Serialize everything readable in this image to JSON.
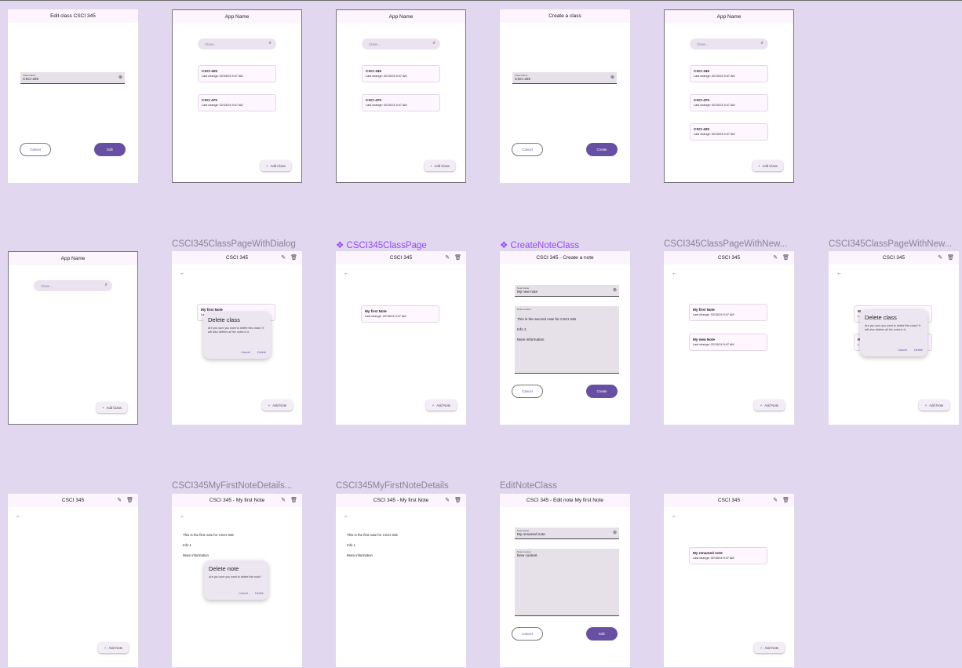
{
  "labels": {
    "f7": "CSCI345ClassPageWithDialog",
    "f8": "CSCI345ClassPage",
    "f9": "CreateNoteClass",
    "f10": "CSCI345ClassPageWithNew...",
    "f11": "CSCI345ClassPageWithNew...",
    "f13": "CSCI345MyFirstNoteDetails...",
    "f14": "CSCI345MyFirstNoteDetails",
    "f15": "EditNoteClass"
  },
  "icons": {
    "diamond": "❖",
    "search": "⌕",
    "clear": "⊗",
    "back": "←",
    "edit": "✎",
    "delete": "🗑",
    "plus": "+"
  },
  "f1": {
    "title": "Edit class CSCI 345",
    "field_label": "Class Name",
    "field_value": "CSCI 425",
    "cancel": "Cancel",
    "action": "Edit"
  },
  "f2": {
    "title": "App Name",
    "search": "Class...",
    "cards": [
      {
        "title": "CSCI 425",
        "sub": "Last change: 02/15/24 9:47 AM"
      },
      {
        "title": "CSCI 470",
        "sub": "Last change: 02/15/24 9:47 AM"
      }
    ],
    "fab": "Add Class"
  },
  "f3": {
    "title": "App Name",
    "search": "Class...",
    "cards": [
      {
        "title": "CSCI 345",
        "sub": "Last change: 02/15/24 9:47 AM"
      },
      {
        "title": "CSCI 470",
        "sub": "Last change: 02/15/24 9:47 AM"
      }
    ],
    "fab": "Add Class"
  },
  "f4": {
    "title": "Create a class",
    "field_label": "Class Name",
    "field_value": "CSCI 425",
    "cancel": "Cancel",
    "action": "Create"
  },
  "f5": {
    "title": "App Name",
    "search": "Class...",
    "cards": [
      {
        "title": "CSCI 345",
        "sub": "Last change: 02/15/24 9:47 AM"
      },
      {
        "title": "CSCI 470",
        "sub": "Last change: 02/15/24 9:47 AM"
      },
      {
        "title": "CSCI 425",
        "sub": "Last change: 02/15/24 9:47 AM"
      }
    ],
    "fab": "Add Class"
  },
  "f6": {
    "title": "App Name",
    "search": "Class...",
    "fab": "Add Class"
  },
  "f7": {
    "title": "CSCI 345",
    "card": "My first Note",
    "card_sub": "La",
    "dialog_title": "Delete class",
    "dialog_body": "Are you sure you want to delete this class? It will also deletes all the notes in it.",
    "cancel": "Cancel",
    "delete": "Delete",
    "fab": "Add Note"
  },
  "f8": {
    "title": "CSCI 345",
    "card": "My first Note",
    "card_sub": "Last change: 02/15/24 9:47 AM",
    "fab": "Add Note"
  },
  "f9": {
    "title": "CSCI 345 - Create a note",
    "name_label": "Note Name",
    "name_value": "My new note",
    "content_label": "Note Content",
    "lines": [
      "This is the second note for CSCI 345",
      "Info 1",
      "More information"
    ],
    "cancel": "Cancel",
    "action": "Create"
  },
  "f10": {
    "title": "CSCI 345",
    "cards": [
      {
        "title": "My first Note",
        "sub": "Last change: 02/15/24 9:47 AM"
      },
      {
        "title": "My new Note",
        "sub": "Last change: 02/15/24 9:47 AM"
      }
    ],
    "fab": "Add Note"
  },
  "f11": {
    "title": "CSCI 345",
    "peek1": "M",
    "peek2": "L",
    "peek3": "M",
    "peek4": "L",
    "dialog_title": "Delete class",
    "dialog_body": "Are you sure you want to delete this class? It will also deletes all the notes in it.",
    "cancel": "Cancel",
    "delete": "Delete",
    "fab": "Add Note"
  },
  "f12": {
    "title": "CSCI 345",
    "fab": "Add Note"
  },
  "f13": {
    "title": "CSCI 345 - My first Note",
    "lines": [
      "This is the first note for CSCI 345",
      "Info 1",
      "More information"
    ],
    "dialog_title": "Delete note",
    "dialog_body": "Are you sure you want to delete this note?",
    "cancel": "Cancel",
    "delete": "Delete"
  },
  "f14": {
    "title": "CSCI 345 - My first Note",
    "lines": [
      "This is the first note for CSCI 345",
      "Info 1",
      "More information"
    ]
  },
  "f15": {
    "title": "CSCI 345 - Edit note My first Note",
    "name_label": "Note Name",
    "name_value": "My renamed note",
    "content_label": "Note Content",
    "content_value": "New content",
    "cancel": "Cancel",
    "action": "Edit"
  },
  "f16": {
    "title": "CSCI 345",
    "card": "My renamed note",
    "card_sub": "Last change: 02/15/24 9:47 AM",
    "fab": "Add Note"
  }
}
